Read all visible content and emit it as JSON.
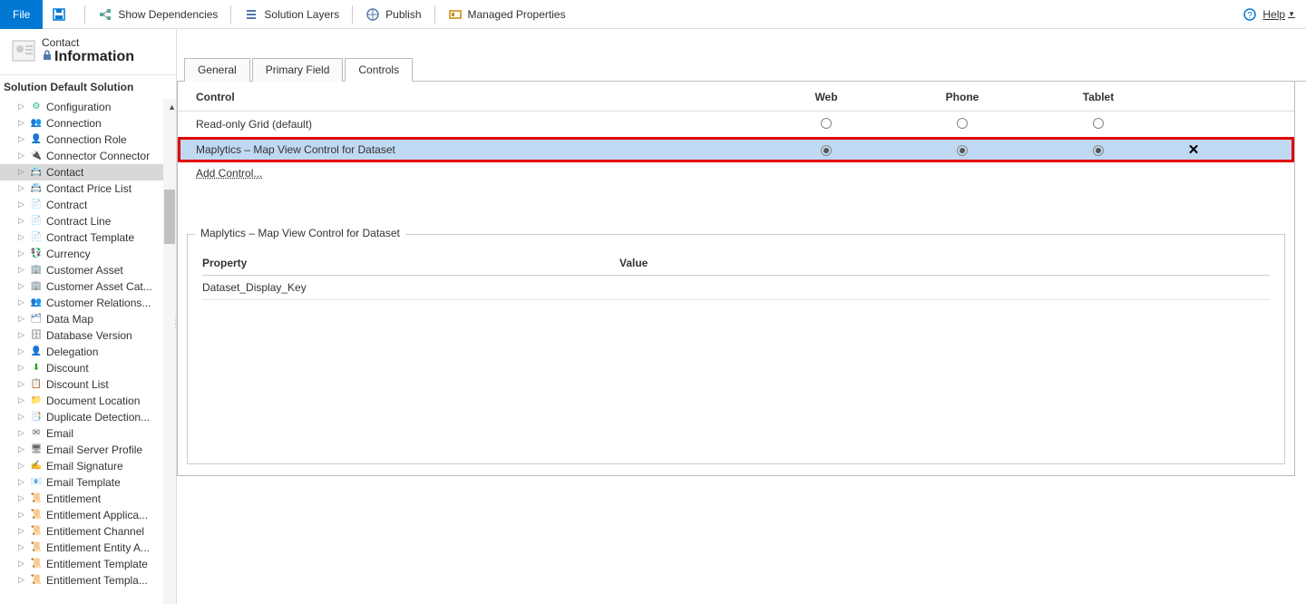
{
  "toolbar": {
    "file": "File",
    "show_dependencies": "Show Dependencies",
    "solution_layers": "Solution Layers",
    "publish": "Publish",
    "managed_properties": "Managed Properties",
    "help": "Help"
  },
  "sidebar": {
    "entity_sub": "Contact",
    "entity_title": "Information",
    "solution_label": "Solution Default Solution",
    "items": [
      {
        "label": "Configuration",
        "icon": "⚙",
        "color": "#2b7"
      },
      {
        "label": "Connection",
        "icon": "👥",
        "color": "#666"
      },
      {
        "label": "Connection Role",
        "icon": "👤",
        "color": "#c66"
      },
      {
        "label": "Connector Connector",
        "icon": "🔌",
        "color": "#666"
      },
      {
        "label": "Contact",
        "icon": "📇",
        "color": "#666",
        "selected": true
      },
      {
        "label": "Contact Price List",
        "icon": "📇",
        "color": "#666"
      },
      {
        "label": "Contract",
        "icon": "📄",
        "color": "#57a"
      },
      {
        "label": "Contract Line",
        "icon": "📄",
        "color": "#c44"
      },
      {
        "label": "Contract Template",
        "icon": "📄",
        "color": "#d80"
      },
      {
        "label": "Currency",
        "icon": "💱",
        "color": "#888"
      },
      {
        "label": "Customer Asset",
        "icon": "🏢",
        "color": "#666"
      },
      {
        "label": "Customer Asset Cat...",
        "icon": "🏢",
        "color": "#666"
      },
      {
        "label": "Customer Relations...",
        "icon": "👥",
        "color": "#666"
      },
      {
        "label": "Data Map",
        "icon": "🗂",
        "color": "#57a"
      },
      {
        "label": "Database Version",
        "icon": "🗄",
        "color": "#666"
      },
      {
        "label": "Delegation",
        "icon": "👤",
        "color": "#666"
      },
      {
        "label": "Discount",
        "icon": "⬇",
        "color": "#2a2"
      },
      {
        "label": "Discount List",
        "icon": "📋",
        "color": "#666"
      },
      {
        "label": "Document Location",
        "icon": "📁",
        "color": "#666"
      },
      {
        "label": "Duplicate Detection...",
        "icon": "📑",
        "color": "#666"
      },
      {
        "label": "Email",
        "icon": "✉",
        "color": "#555"
      },
      {
        "label": "Email Server Profile",
        "icon": "🖥",
        "color": "#666"
      },
      {
        "label": "Email Signature",
        "icon": "✍",
        "color": "#666"
      },
      {
        "label": "Email Template",
        "icon": "📧",
        "color": "#666"
      },
      {
        "label": "Entitlement",
        "icon": "📜",
        "color": "#666"
      },
      {
        "label": "Entitlement Applica...",
        "icon": "📜",
        "color": "#666"
      },
      {
        "label": "Entitlement Channel",
        "icon": "📜",
        "color": "#666"
      },
      {
        "label": "Entitlement Entity A...",
        "icon": "📜",
        "color": "#666"
      },
      {
        "label": "Entitlement Template",
        "icon": "📜",
        "color": "#666"
      },
      {
        "label": "Entitlement Templa...",
        "icon": "📜",
        "color": "#666"
      }
    ]
  },
  "tabs": {
    "general": "General",
    "primary_field": "Primary Field",
    "controls": "Controls"
  },
  "grid": {
    "hdr_control": "Control",
    "hdr_web": "Web",
    "hdr_phone": "Phone",
    "hdr_tablet": "Tablet",
    "rows": [
      {
        "name": "Read-only Grid (default)",
        "web": false,
        "phone": false,
        "tablet": false,
        "deletable": false,
        "highlight": false
      },
      {
        "name": "Maplytics – Map View Control for Dataset",
        "web": true,
        "phone": true,
        "tablet": true,
        "deletable": true,
        "highlight": true
      }
    ],
    "add_link": "Add Control..."
  },
  "properties": {
    "legend": "Maplytics – Map View Control for Dataset",
    "hdr_prop": "Property",
    "hdr_value": "Value",
    "rows": [
      {
        "prop": "Dataset_Display_Key",
        "value": ""
      }
    ]
  }
}
